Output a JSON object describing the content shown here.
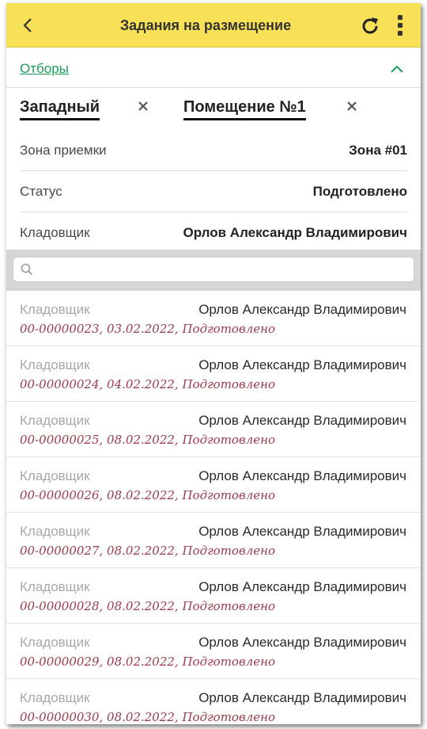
{
  "header": {
    "title": "Задания на размещение",
    "back_icon": "chevron-left-icon",
    "refresh_icon": "refresh-icon",
    "more_icon": "more-vertical-icon",
    "color": "#f9e157"
  },
  "filters": {
    "label": "Отборы",
    "collapse_icon": "chevron-up-icon",
    "accent": "#1a9e5a"
  },
  "tags": [
    {
      "label": "Западный"
    },
    {
      "label": "Помещение №1"
    }
  ],
  "details": [
    {
      "label": "Зона приемки",
      "value": "Зона #01"
    },
    {
      "label": "Статус",
      "value": "Подготовлено"
    },
    {
      "label": "Кладовщик",
      "value": "Орлов Александр Владимирович"
    }
  ],
  "search": {
    "placeholder": "",
    "value": ""
  },
  "list": [
    {
      "label": "Кладовщик",
      "person": "Орлов Александр Владимирович",
      "meta": "00-00000023, 03.02.2022, Подготовлено"
    },
    {
      "label": "Кладовщик",
      "person": "Орлов Александр Владимирович",
      "meta": "00-00000024, 04.02.2022, Подготовлено"
    },
    {
      "label": "Кладовщик",
      "person": "Орлов Александр Владимирович",
      "meta": "00-00000025, 08.02.2022, Подготовлено"
    },
    {
      "label": "Кладовщик",
      "person": "Орлов Александр Владимирович",
      "meta": "00-00000026, 08.02.2022, Подготовлено"
    },
    {
      "label": "Кладовщик",
      "person": "Орлов Александр Владимирович",
      "meta": "00-00000027, 08.02.2022, Подготовлено"
    },
    {
      "label": "Кладовщик",
      "person": "Орлов Александр Владимирович",
      "meta": "00-00000028, 08.02.2022, Подготовлено"
    },
    {
      "label": "Кладовщик",
      "person": "Орлов Александр Владимирович",
      "meta": "00-00000029, 08.02.2022, Подготовлено"
    },
    {
      "label": "Кладовщик",
      "person": "Орлов Александр Владимирович",
      "meta": "00-00000030, 08.02.2022, Подготовлено"
    }
  ]
}
